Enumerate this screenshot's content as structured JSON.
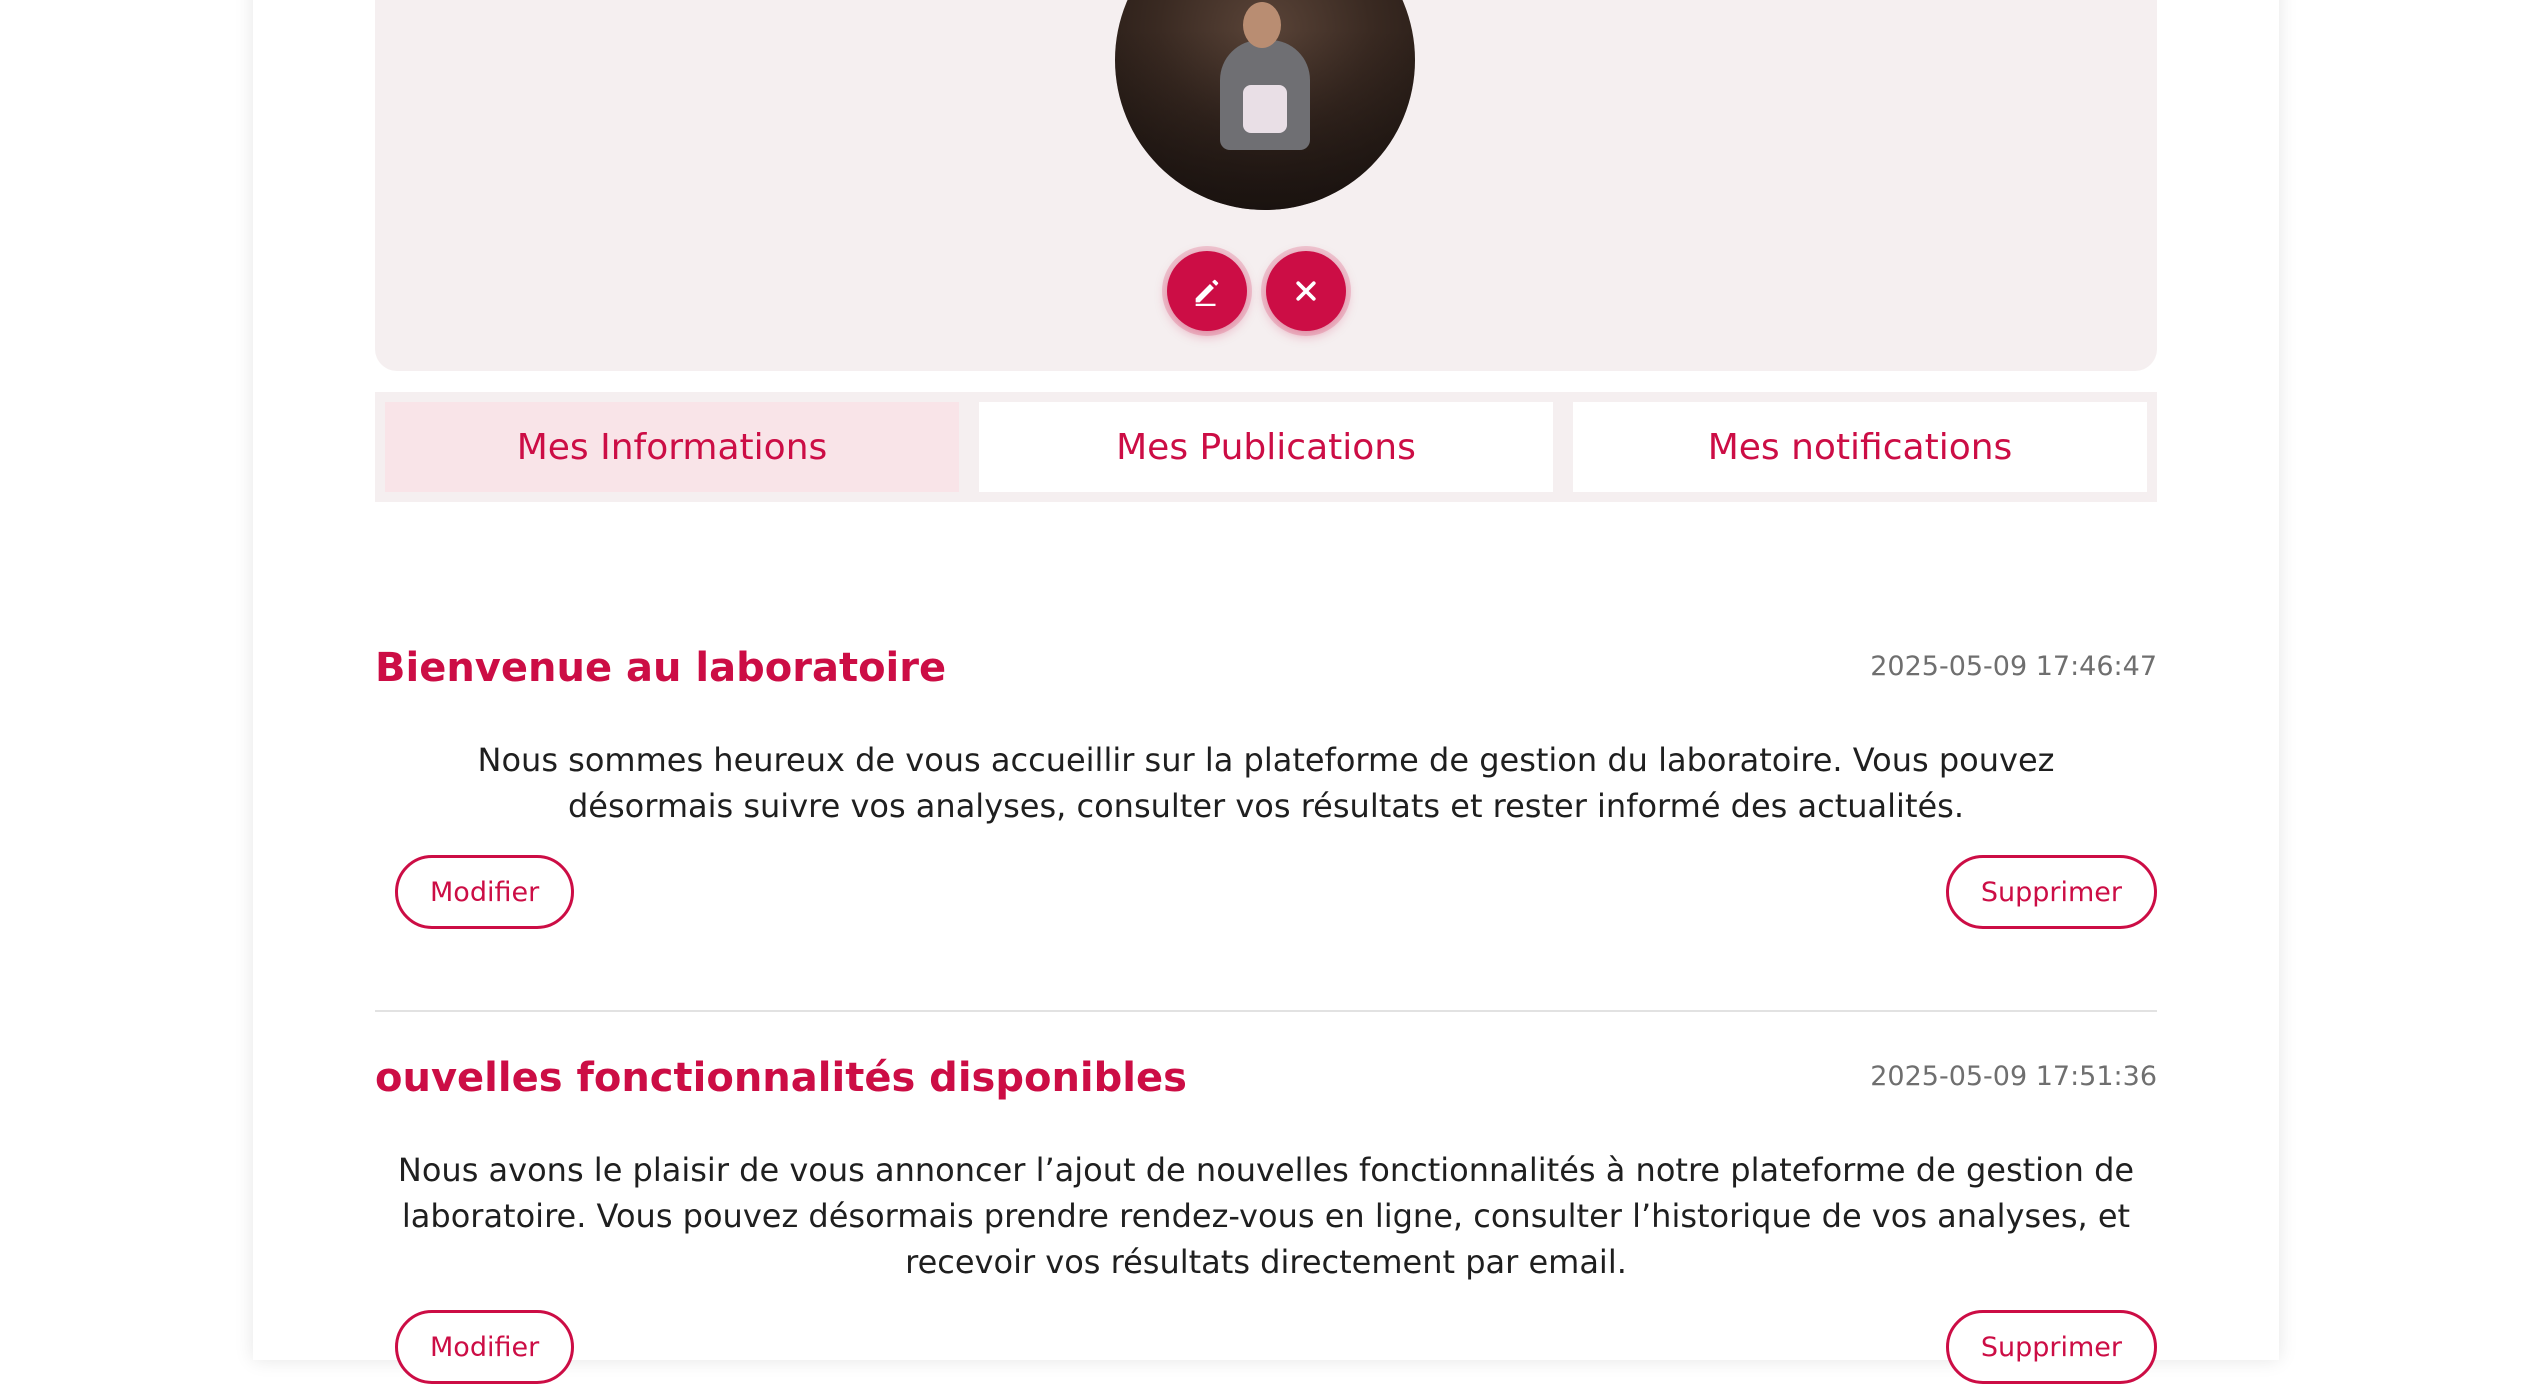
{
  "profile": {
    "edit_button_icon": "pencil-icon",
    "remove_button_icon": "close-icon"
  },
  "tabs": [
    {
      "label": "Mes Informations",
      "active": true
    },
    {
      "label": "Mes Publications",
      "active": false
    },
    {
      "label": "Mes notifications",
      "active": false
    }
  ],
  "posts": [
    {
      "title": "Bienvenue au laboratoire",
      "date": "2025-05-09 17:46:47",
      "body": "Nous sommes heureux de vous accueillir sur la plateforme de gestion du laboratoire. Vous pouvez désormais suivre vos analyses, consulter vos résultats et rester informé des actualités.",
      "edit_label": "Modifier",
      "delete_label": "Supprimer"
    },
    {
      "title": "ouvelles fonctionnalités disponibles",
      "date": "2025-05-09 17:51:36",
      "body": "Nous avons le plaisir de vous annoncer l’ajout de nouvelles fonctionnalités à notre plateforme de gestion de laboratoire. Vous pouvez désormais prendre rendez-vous en ligne, consulter l’historique de vos analyses, et recevoir vos résultats directement par email.",
      "edit_label": "Modifier",
      "delete_label": "Supprimer"
    }
  ],
  "colors": {
    "accent": "#cc0d45",
    "panel": "#f5eff0",
    "active_tab": "#f9e4e8"
  }
}
